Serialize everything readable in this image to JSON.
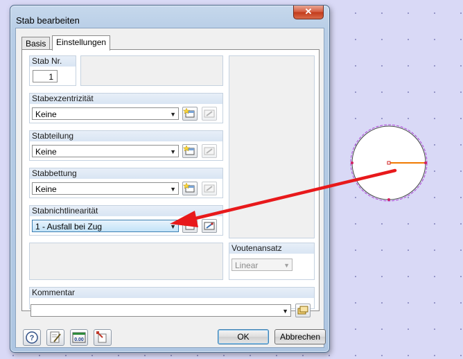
{
  "window": {
    "title": "Stab bearbeiten",
    "close_label": "✕"
  },
  "tabs": [
    {
      "label": "Basis",
      "active": false
    },
    {
      "label": "Einstellungen",
      "active": true
    }
  ],
  "stab_nr": {
    "label": "Stab Nr.",
    "value": "1"
  },
  "stabexzentrizitaet": {
    "label": "Stabexzentrizität",
    "selected": "Keine"
  },
  "stabteilung": {
    "label": "Stabteilung",
    "selected": "Keine"
  },
  "stabbettung": {
    "label": "Stabbettung",
    "selected": "Keine"
  },
  "stabnichtlinearitaet": {
    "label": "Stabnichtlinearität",
    "selected": "1 - Ausfall bei Zug"
  },
  "voutenansatz": {
    "label": "Voutenansatz",
    "selected": "Linear"
  },
  "kommentar": {
    "label": "Kommentar",
    "value": ""
  },
  "footer": {
    "ok_label": "OK",
    "cancel_label": "Abbrechen"
  },
  "colors": {
    "arrow": "#e8191b",
    "member_line": "#f07a00",
    "background": "#d9d9f6"
  }
}
